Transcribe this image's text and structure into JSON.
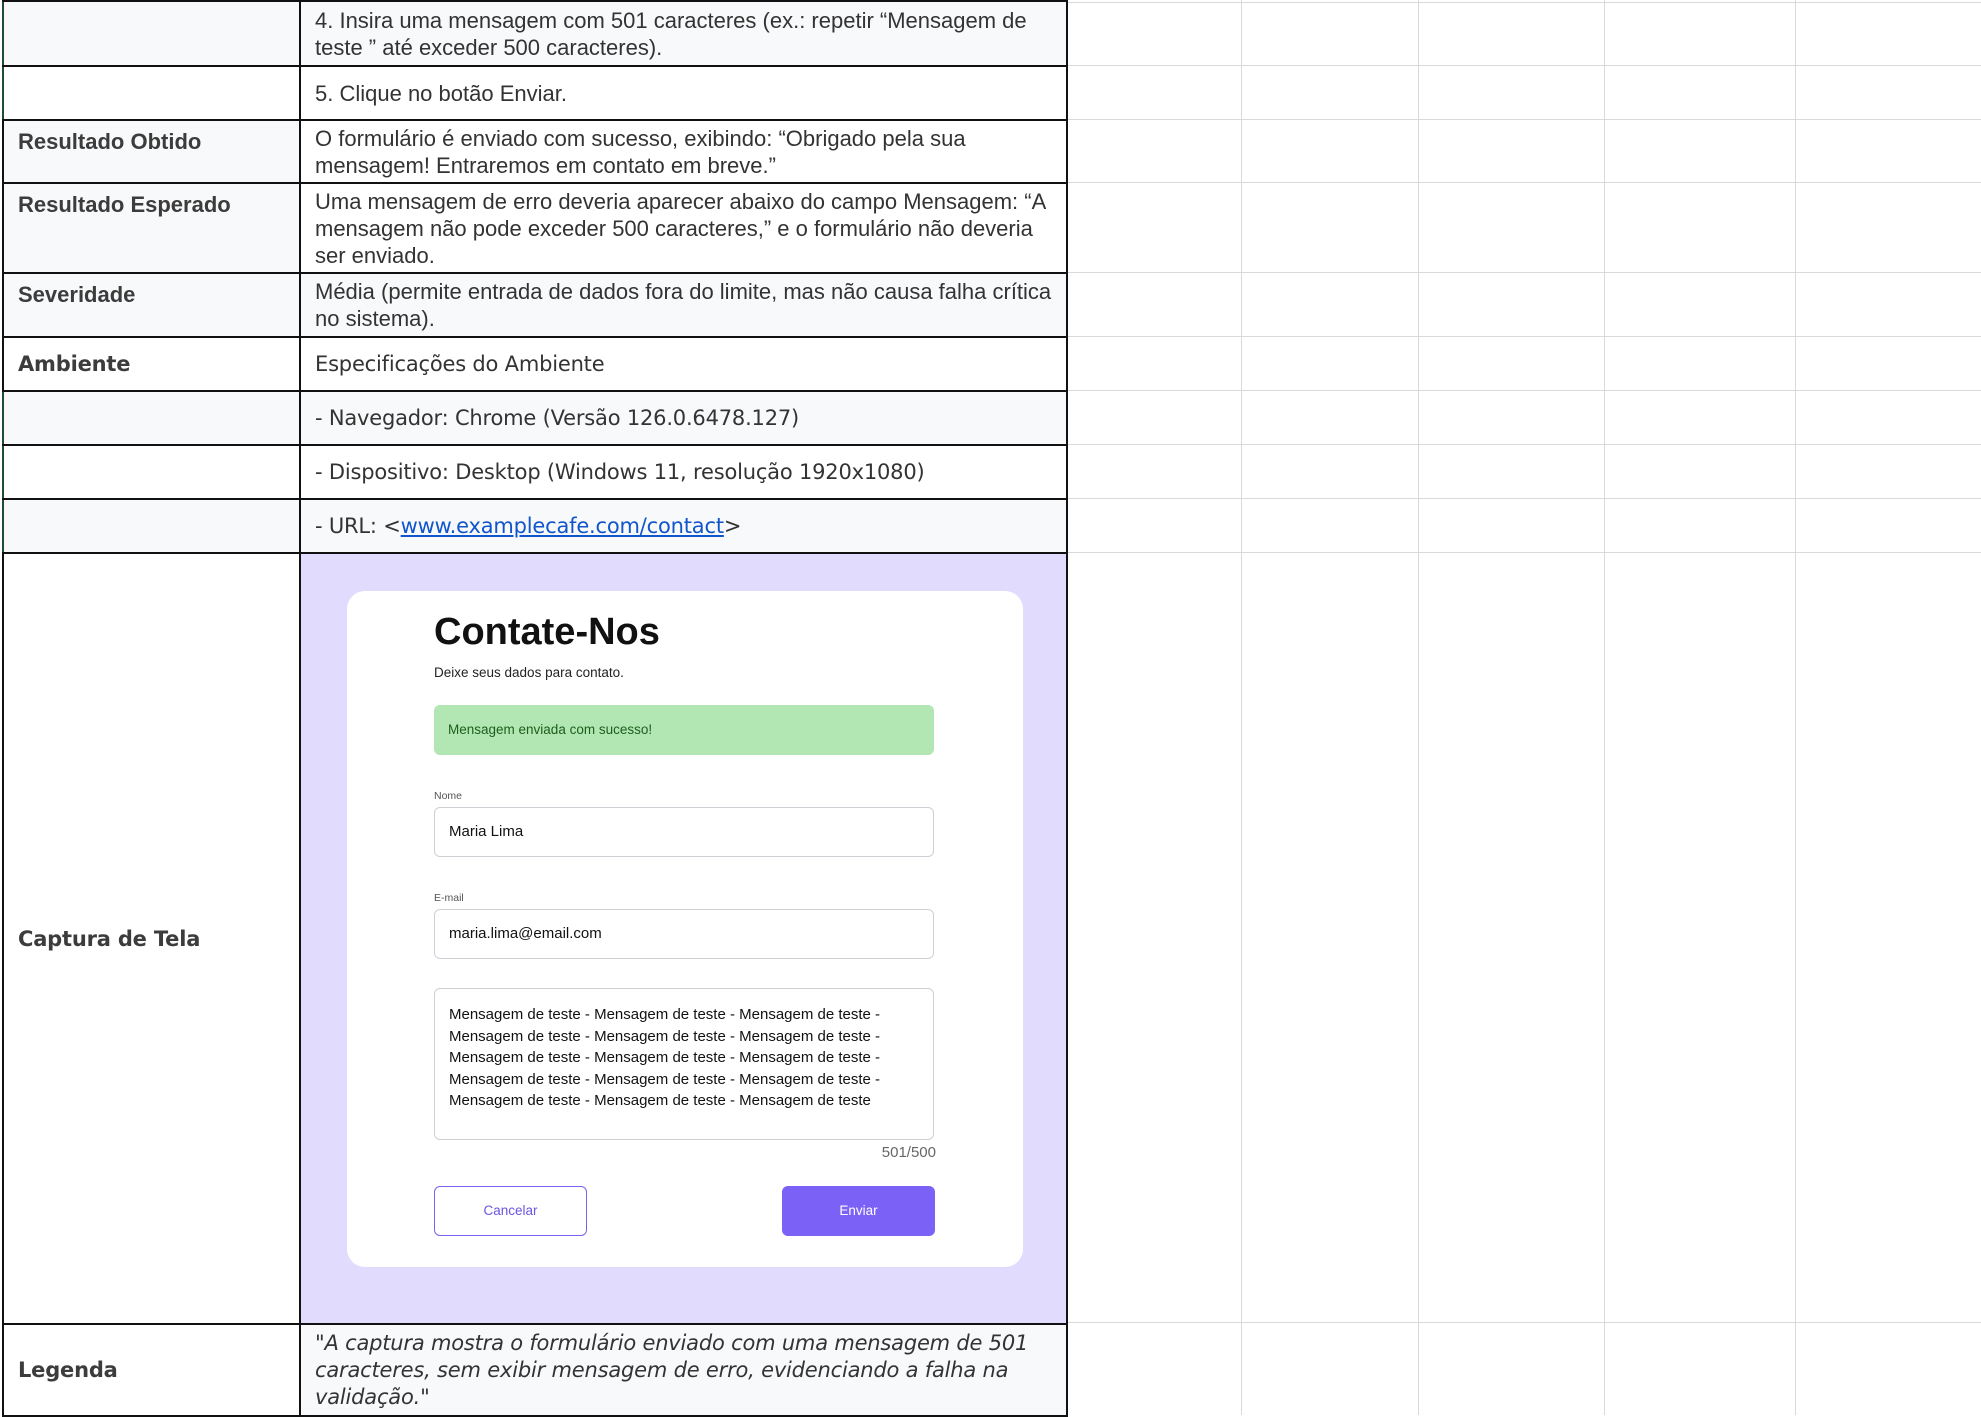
{
  "rows": {
    "step4": "4. Insira uma mensagem com 501 caracteres (ex.: repetir “Mensagem de teste ” até exceder 500 caracteres).",
    "step5": "5. Clique no botão Enviar.",
    "obtido_label": "Resultado Obtido",
    "obtido_value": "O formulário é enviado com sucesso, exibindo: “Obrigado pela sua mensagem! Entraremos em contato em breve.”",
    "esperado_label": "Resultado Esperado",
    "esperado_value": "Uma mensagem de erro deveria aparecer abaixo do campo Mensagem: “A mensagem não pode exceder 500 caracteres,” e o formulário não deveria ser enviado.",
    "severidade_label": "Severidade",
    "severidade_value": "Média (permite entrada de dados fora do limite, mas não causa falha crítica no sistema).",
    "ambiente_label": "Ambiente",
    "ambiente_value": "Especificações do Ambiente",
    "navegador": "- Navegador: Chrome (Versão 126.0.6478.127)",
    "dispositivo": "- Dispositivo: Desktop (Windows 11, resolução 1920x1080)",
    "url_prefix": "- URL: <",
    "url_link": "www.examplecafe.com/contact",
    "url_suffix": ">",
    "captura_label": "Captura de Tela",
    "legenda_label": "Legenda",
    "legenda_value": "\"A captura mostra o formulário enviado com uma mensagem de 501 caracteres, sem exibir mensagem de erro, evidenciando a falha na validação.\""
  },
  "form": {
    "title": "Contate-Nos",
    "subtitle": "Deixe seus dados para contato.",
    "alert": "Mensagem enviada com sucesso!",
    "name_label": "Nome",
    "name_value": "Maria Lima",
    "email_label": "E-mail",
    "email_value": "maria.lima@email.com",
    "message_value": "Mensagem de teste - Mensagem de teste - Mensagem de teste - Mensagem de teste - Mensagem de teste - Mensagem de teste - Mensagem de teste - Mensagem de teste - Mensagem de teste - Mensagem de teste - Mensagem de teste - Mensagem de teste - Mensagem de teste - Mensagem de teste - Mensagem de teste",
    "counter": "501/500",
    "cancel_label": "Cancelar",
    "send_label": "Enviar"
  },
  "colors": {
    "shot_background": "#e1dbfe",
    "alert_background": "#b2e6b2",
    "primary_button": "#7b61f5",
    "link": "#1155cc"
  }
}
